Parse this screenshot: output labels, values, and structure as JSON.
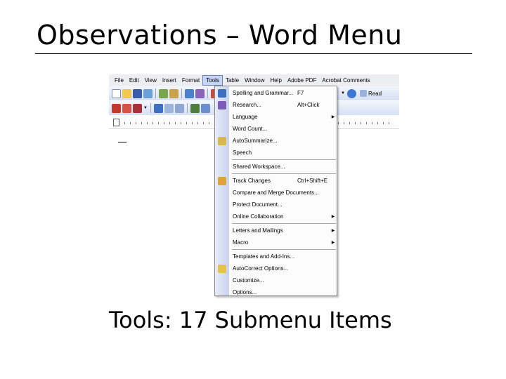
{
  "slide": {
    "title": "Observations – Word Menu",
    "caption": "Tools: 17 Submenu Items"
  },
  "menubar": {
    "items": [
      "File",
      "Edit",
      "View",
      "Insert",
      "Format",
      "Tools",
      "Table",
      "Window",
      "Help",
      "Adobe PDF",
      "Acrobat Comments"
    ],
    "open_item": "Tools"
  },
  "toolbar": {
    "read_label": "Read"
  },
  "tools_menu": {
    "items": [
      {
        "label": "Spelling and Grammar...",
        "shortcut": "F7",
        "submenu": false,
        "icon": "spelling-icon"
      },
      {
        "label": "Research...",
        "shortcut": "Alt+Click",
        "submenu": false,
        "icon": "research-icon"
      },
      {
        "label": "Language",
        "shortcut": "",
        "submenu": true,
        "icon": ""
      },
      {
        "label": "Word Count...",
        "shortcut": "",
        "submenu": false,
        "icon": ""
      },
      {
        "label": "AutoSummarize...",
        "shortcut": "",
        "submenu": false,
        "icon": "autosummarize-icon"
      },
      {
        "label": "Speech",
        "shortcut": "",
        "submenu": false,
        "icon": ""
      },
      {
        "label": "Shared Workspace...",
        "shortcut": "",
        "submenu": false,
        "icon": ""
      },
      {
        "label": "Track Changes",
        "shortcut": "Ctrl+Shift+E",
        "submenu": false,
        "icon": "track-changes-icon"
      },
      {
        "label": "Compare and Merge Documents...",
        "shortcut": "",
        "submenu": false,
        "icon": ""
      },
      {
        "label": "Protect Document...",
        "shortcut": "",
        "submenu": false,
        "icon": ""
      },
      {
        "label": "Online Collaboration",
        "shortcut": "",
        "submenu": true,
        "icon": ""
      },
      {
        "label": "Letters and Mailings",
        "shortcut": "",
        "submenu": true,
        "icon": ""
      },
      {
        "label": "Macro",
        "shortcut": "",
        "submenu": true,
        "icon": ""
      },
      {
        "label": "Templates and Add-Ins...",
        "shortcut": "",
        "submenu": false,
        "icon": ""
      },
      {
        "label": "AutoCorrect Options...",
        "shortcut": "",
        "submenu": false,
        "icon": "autocorrect-icon"
      },
      {
        "label": "Customize...",
        "shortcut": "",
        "submenu": false,
        "icon": ""
      },
      {
        "label": "Options...",
        "shortcut": "",
        "submenu": false,
        "icon": ""
      }
    ]
  },
  "colors": {
    "menu_highlight": "#c5d5f3",
    "toolbar_top": "#f3f6fc",
    "toolbar_bottom": "#d5e0f3"
  }
}
